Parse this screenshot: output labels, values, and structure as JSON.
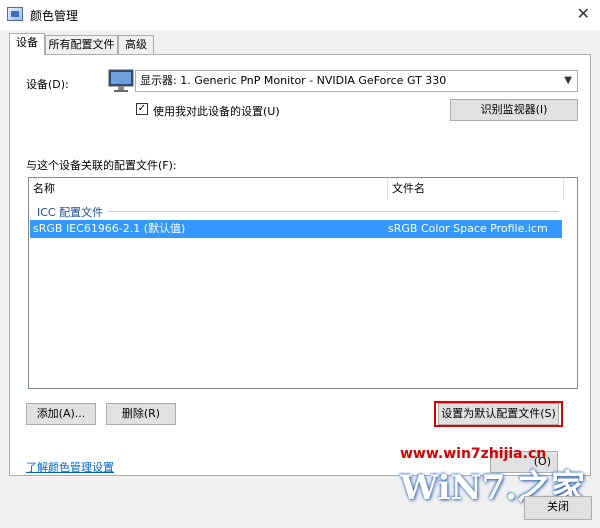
{
  "window": {
    "title": "颜色管理",
    "close_glyph": "✕"
  },
  "tabs": [
    {
      "label": "设备"
    },
    {
      "label": "所有配置文件"
    },
    {
      "label": "高级"
    }
  ],
  "device": {
    "label": "设备(D):",
    "selected": "显示器: 1. Generic PnP Monitor - NVIDIA GeForce GT 330",
    "use_my_settings_label": "使用我对此设备的设置(U)",
    "use_my_settings_checked": true,
    "identify_button": "识别监视器(I)"
  },
  "profiles": {
    "section_label": "与这个设备关联的配置文件(F):",
    "columns": [
      "名称",
      "文件名"
    ],
    "group": "ICC 配置文件",
    "rows": [
      {
        "name": "sRGB IEC61966-2.1 (默认值)",
        "file": "sRGB Color Space Profile.icm",
        "selected": true
      }
    ]
  },
  "actions": {
    "add": "添加(A)...",
    "remove": "删除(R)",
    "set_default": "设置为默认配置文件(S)"
  },
  "footer": {
    "learn_link": "了解颜色管理设置",
    "profiles_button_partial": "(O)",
    "close_button": "关闭"
  },
  "watermark": {
    "site": "www.win7zhijia.cn",
    "logo_text": "WiN7.之家"
  },
  "colors": {
    "selection": "#3399ff",
    "highlight_border": "#e00000",
    "link": "#0066cc"
  }
}
